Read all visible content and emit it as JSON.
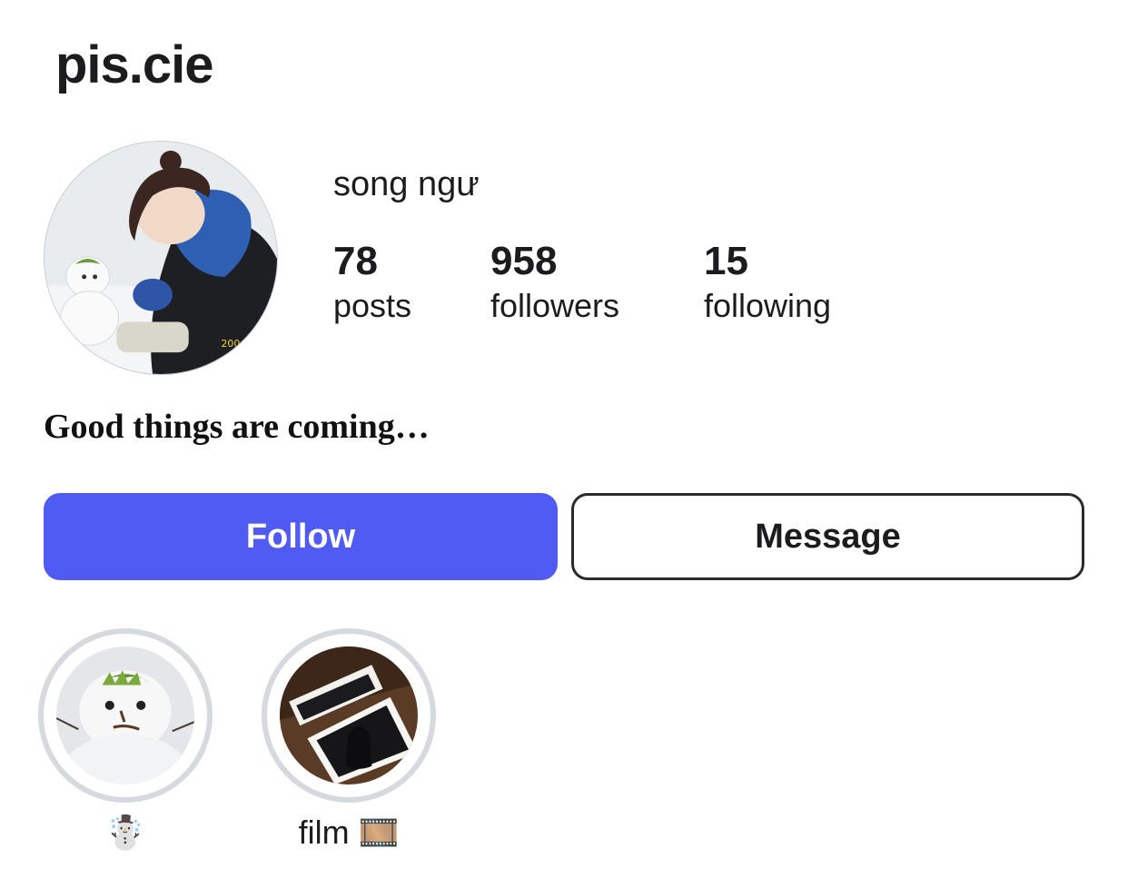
{
  "profile": {
    "username": "pis.cie",
    "display_name": "song ngư",
    "bio": "Good things are coming…",
    "avatar_stamp": "200"
  },
  "stats": [
    {
      "value": "78",
      "label": "posts"
    },
    {
      "value": "958",
      "label": "followers"
    },
    {
      "value": "15",
      "label": "following"
    }
  ],
  "actions": {
    "follow_label": "Follow",
    "message_label": "Message"
  },
  "highlights": [
    {
      "caption": "☃️",
      "icon": "snowman-photo"
    },
    {
      "caption": "film 🎞️",
      "icon": "film-photo"
    }
  ],
  "colors": {
    "follow_button": "#4f5bf2",
    "highlight_ring": "#d6d9de"
  }
}
